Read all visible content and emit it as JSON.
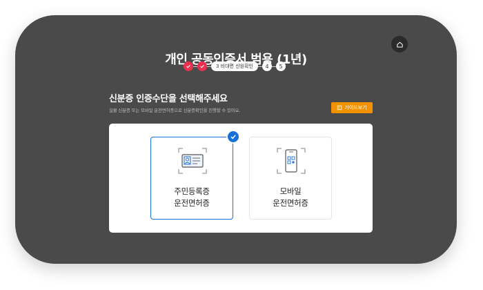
{
  "header": {
    "title": "개인 공동인증서 범용 (1년)"
  },
  "stepper": {
    "done_steps": [
      "✓",
      "✓"
    ],
    "current_label": "3 비대면 신원확인",
    "upcoming": [
      "4",
      "5"
    ]
  },
  "section": {
    "title": "신분증 인증수단을 선택해주세요",
    "subtitle": "실물 신분증 또는 모바일 운전면허증으로 신분증확인을 진행할 수 있어요."
  },
  "guide_button": {
    "label": "가이드보기"
  },
  "options": [
    {
      "line1": "주민등록증",
      "line2": "운전면허증",
      "selected": true
    },
    {
      "line1": "모바일",
      "line2": "운전면허증",
      "selected": false
    }
  ],
  "colors": {
    "background": "#4a4a4a",
    "step_done": "#e8304f",
    "accent_blue": "#1a6fd8",
    "guide_orange": "#f39200"
  },
  "icons": {
    "home": "home-icon",
    "check": "check-icon",
    "id_card": "id-card-icon",
    "mobile_qr": "mobile-qr-icon",
    "guide": "book-icon"
  }
}
